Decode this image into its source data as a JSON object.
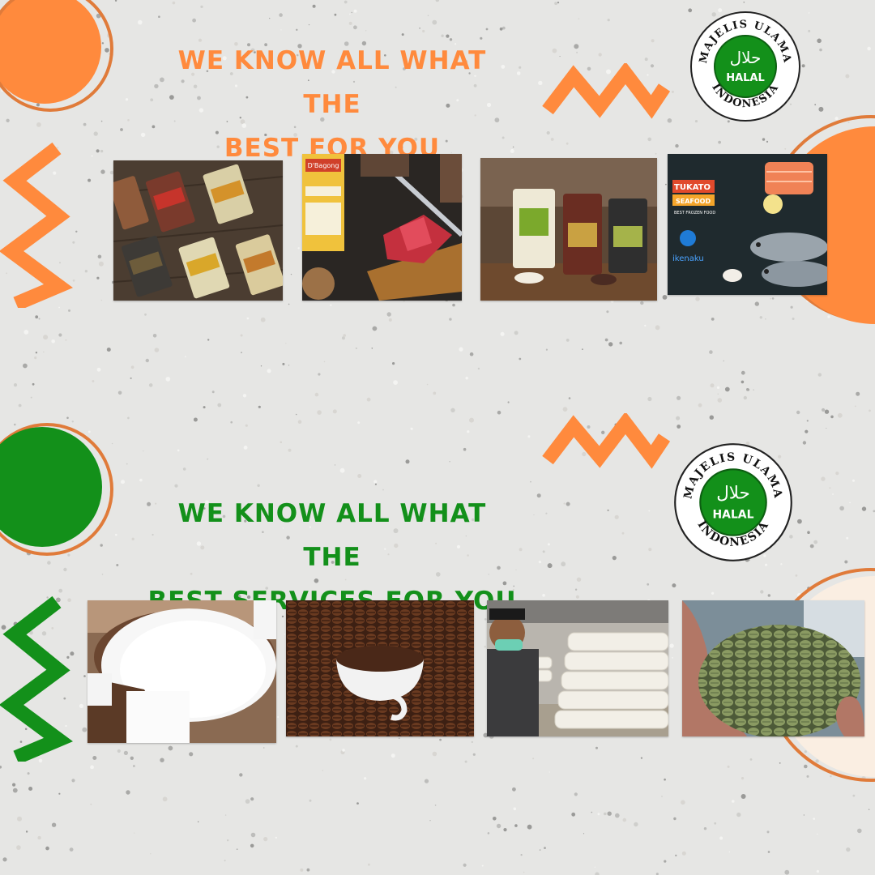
{
  "top": {
    "line1": "WE KNOW ALL WHAT THE",
    "line2": "BEST FOR YOU",
    "color": "#ff8a3d",
    "photos": [
      {
        "icon": "rice-packages-photo"
      },
      {
        "icon": "beef-cutting-photo",
        "label": "D'Bagong"
      },
      {
        "icon": "rice-bags-photo"
      },
      {
        "icon": "seafood-photo",
        "brand": "TUKATO",
        "brand_sub": "SEAFOOD",
        "tagline": "BEST FROZEN FOOD",
        "brand2": "ikenaku"
      }
    ]
  },
  "bottom": {
    "line1": "WE KNOW ALL WHAT THE",
    "line2": "BEST SERVICES FOR YOU",
    "color": "#13901a",
    "photos": [
      {
        "icon": "sugar-photo"
      },
      {
        "icon": "coffee-beans-photo"
      },
      {
        "icon": "warehouse-sacks-photo"
      },
      {
        "icon": "green-coffee-beans-photo"
      }
    ]
  },
  "seal": {
    "top_text": "MAJELIS ULAMA",
    "bottom_text": "INDONESIA",
    "center_text": "HALAL",
    "arabic": "حلال",
    "color": "#13901a"
  },
  "colors": {
    "accent_orange": "#ff8a3d",
    "accent_green": "#13901a",
    "background": "#e6e6e4"
  }
}
